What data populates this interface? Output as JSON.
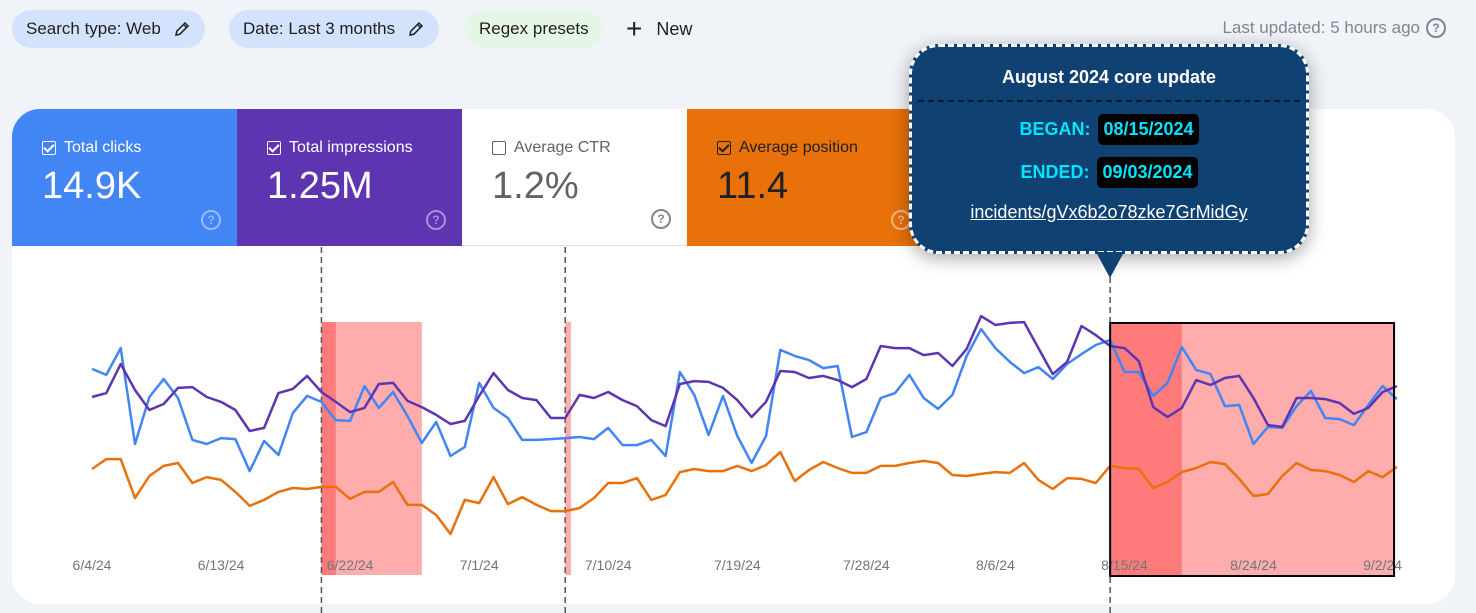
{
  "filters": {
    "search_type": "Search type: Web",
    "date": "Date: Last 3 months",
    "regex": "Regex presets",
    "new_label": "New"
  },
  "last_updated": "Last updated: 5 hours ago",
  "metrics": [
    {
      "label": "Total clicks",
      "value": "14.9K",
      "checked": true
    },
    {
      "label": "Total impressions",
      "value": "1.25M",
      "checked": true
    },
    {
      "label": "Average CTR",
      "value": "1.2%",
      "checked": false
    },
    {
      "label": "Average position",
      "value": "11.4",
      "checked": true
    }
  ],
  "colors": {
    "clicks": "#4285f4",
    "impressions": "#5e35b1",
    "position": "#e8710a",
    "highlight_light": "#ff8080",
    "highlight_dark": "#ff4040",
    "tooltip_bg": "#0f4173",
    "tooltip_accent": "#00e5ff"
  },
  "tooltip": {
    "title": "August 2024 core update",
    "began_label": "BEGAN:",
    "began_value": "08/15/2024",
    "ended_label": "ENDED:",
    "ended_value": "09/03/2024",
    "link": "incidents/gVx6b2o78zke7GrMidGy"
  },
  "chart_data": {
    "type": "line",
    "title": "",
    "xlabel": "",
    "ylabel": "",
    "note": "No y-axis shown; series values are relative (0-100 scale of plot height), each series independently scaled.",
    "x_start": "6/4/24",
    "x_end": "9/3/24",
    "x_tick_labels": [
      "6/4/24",
      "6/13/24",
      "6/22/24",
      "7/1/24",
      "7/10/24",
      "7/19/24",
      "7/28/24",
      "8/6/24",
      "8/15/24",
      "8/24/24",
      "9/2/24"
    ],
    "x_tick_day_index": [
      0,
      9,
      18,
      27,
      36,
      45,
      54,
      63,
      72,
      81,
      90
    ],
    "grid": false,
    "legend": "metric cards at top",
    "ylim": [
      0,
      100
    ],
    "annotations": [
      {
        "type": "event_line",
        "day_index": 16
      },
      {
        "type": "event_line",
        "day_index": 33
      },
      {
        "type": "event_line",
        "day_index": 71
      },
      {
        "type": "shaded_range",
        "start_day_index": 16,
        "end_day_index": 23,
        "dark_days": 1
      },
      {
        "type": "shaded_range",
        "start_day_index": 33,
        "end_day_index": 33.4,
        "dark_days": 0
      },
      {
        "type": "shaded_range",
        "start_day_index": 71,
        "end_day_index": 90.8,
        "dark_days": 5,
        "outlined": true,
        "label": "August 2024 core update"
      }
    ],
    "series": [
      {
        "name": "Total clicks",
        "values": [
          73.5,
          71.2,
          81.5,
          44.6,
          62.7,
          69.6,
          62.3,
          46.2,
          44.6,
          46.9,
          46.5,
          34.2,
          45.8,
          40.4,
          56.5,
          63.1,
          60.8,
          53.8,
          53.5,
          66.9,
          58.5,
          64.6,
          55.4,
          45.0,
          53.1,
          40.0,
          43.5,
          68.1,
          58.5,
          54.6,
          46.2,
          46.2,
          46.5,
          46.9,
          47.3,
          46.5,
          50.8,
          44.2,
          44.2,
          46.2,
          40.0,
          72.3,
          63.5,
          48.1,
          63.1,
          47.7,
          37.3,
          47.7,
          80.8,
          78.5,
          76.9,
          73.8,
          74.6,
          47.3,
          49.2,
          62.3,
          64.2,
          71.2,
          62.3,
          58.1,
          63.5,
          78.5,
          88.8,
          81.5,
          76.2,
          71.9,
          74.2,
          69.6,
          75.4,
          79.2,
          82.7,
          84.6,
          72.3,
          72.3,
          63.1,
          68.1,
          81.9,
          73.1,
          71.5,
          59.2,
          59.6,
          44.6,
          51.2,
          50.8,
          59.2,
          65.0,
          54.6,
          54.2,
          51.9,
          59.6,
          66.9,
          61.9
        ]
      },
      {
        "name": "Total impressions",
        "values": [
          62.7,
          64.2,
          75.4,
          65.4,
          57.7,
          60.0,
          66.2,
          66.5,
          62.7,
          60.8,
          57.7,
          49.6,
          50.8,
          64.2,
          65.8,
          70.8,
          64.6,
          60.8,
          56.9,
          58.5,
          67.7,
          68.1,
          61.2,
          58.8,
          55.8,
          52.3,
          53.5,
          63.1,
          71.9,
          65.4,
          62.3,
          61.5,
          54.6,
          54.6,
          63.5,
          62.3,
          64.6,
          61.5,
          59.2,
          53.8,
          51.5,
          67.7,
          68.8,
          68.5,
          66.2,
          61.5,
          55.0,
          60.8,
          72.7,
          72.3,
          70.0,
          70.8,
          69.2,
          66.5,
          69.6,
          82.3,
          81.5,
          81.5,
          78.8,
          79.6,
          74.6,
          81.2,
          93.8,
          90.4,
          91.2,
          91.5,
          81.5,
          71.5,
          76.2,
          90.0,
          86.5,
          82.3,
          81.5,
          76.5,
          58.8,
          55.0,
          58.5,
          69.2,
          67.3,
          70.0,
          70.8,
          62.3,
          51.9,
          51.2,
          62.3,
          62.3,
          61.9,
          60.4,
          56.2,
          58.5,
          64.6,
          66.9
        ]
      },
      {
        "name": "Average position",
        "values": [
          35.0,
          38.8,
          38.8,
          23.8,
          32.3,
          36.2,
          37.3,
          29.6,
          31.9,
          30.8,
          26.2,
          20.8,
          23.1,
          26.2,
          27.7,
          27.3,
          28.1,
          28.1,
          23.5,
          26.2,
          26.2,
          30.0,
          21.2,
          21.2,
          17.3,
          10.0,
          23.1,
          21.9,
          31.9,
          21.5,
          24.2,
          21.2,
          18.8,
          18.8,
          20.0,
          23.8,
          29.6,
          29.6,
          31.5,
          23.1,
          25.0,
          33.8,
          35.0,
          34.2,
          34.2,
          36.2,
          34.2,
          36.5,
          41.5,
          30.4,
          34.6,
          37.7,
          35.4,
          33.5,
          33.5,
          36.2,
          36.2,
          37.3,
          38.1,
          37.3,
          32.7,
          32.3,
          33.1,
          33.8,
          33.5,
          37.3,
          30.8,
          27.3,
          31.5,
          31.2,
          29.6,
          36.2,
          35.4,
          35.0,
          27.7,
          30.0,
          33.8,
          35.4,
          37.7,
          36.9,
          31.2,
          24.6,
          25.4,
          32.3,
          37.3,
          34.6,
          34.2,
          32.7,
          30.0,
          34.2,
          31.9,
          35.8
        ]
      }
    ]
  }
}
